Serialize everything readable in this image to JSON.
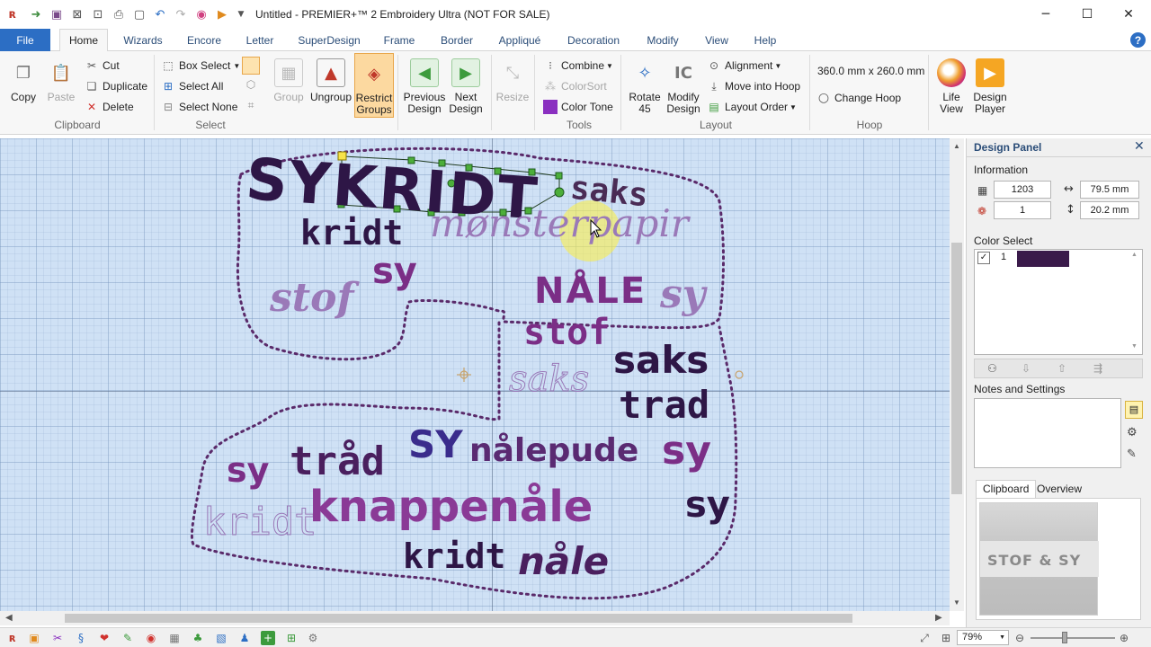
{
  "window": {
    "title": "Untitled - PREMIER+™ 2 Embroidery Ultra (NOT FOR SALE)",
    "minimize": "─",
    "maximize": "☐",
    "close": "✕"
  },
  "tabs": {
    "file": "File",
    "items": [
      "Home",
      "Wizards",
      "Encore",
      "Letter",
      "SuperDesign",
      "Frame",
      "Border",
      "Appliqué",
      "Decoration",
      "Modify",
      "View",
      "Help"
    ],
    "active": "Home"
  },
  "ribbon": {
    "clipboard": {
      "label": "Clipboard",
      "copy": "Copy",
      "paste": "Paste",
      "cut": "Cut",
      "duplicate": "Duplicate",
      "delete": "Delete"
    },
    "select": {
      "label": "Select",
      "box_select": "Box Select",
      "select_all": "Select All",
      "select_none": "Select None",
      "group": "Group",
      "ungroup": "Ungroup",
      "restrict_1": "Restrict",
      "restrict_2": "Groups"
    },
    "nav": {
      "prev_1": "Previous",
      "prev_2": "Design",
      "next_1": "Next",
      "next_2": "Design",
      "resize": "Resize"
    },
    "tools": {
      "label": "Tools",
      "combine": "Combine",
      "colorsort": "ColorSort",
      "color_tone": "Color Tone"
    },
    "layout": {
      "label": "Layout",
      "rotate_1": "Rotate",
      "rotate_2": "45",
      "modify_1": "Modify",
      "modify_2": "Design",
      "alignment": "Alignment",
      "move_into_hoop": "Move into Hoop",
      "layout_order": "Layout Order"
    },
    "hoop": {
      "label": "Hoop",
      "size": "360.0 mm x 260.0 mm",
      "change_hoop": "Change Hoop"
    },
    "view": {
      "life_1": "Life",
      "life_2": "View",
      "player_1": "Design",
      "player_2": "Player"
    }
  },
  "canvas": {
    "words": {
      "sykridt": "SYKRIDT",
      "saks1": "saks",
      "kridt1": "kridt",
      "monsterpapir": "mønsterpapir",
      "sy1": "sy",
      "stof1": "stof",
      "nale1": "NÅLE",
      "sy2": "sy",
      "stof2": "stof",
      "saks2": "saks",
      "saks3": "saks",
      "trad1": "trad",
      "sy3": "sy",
      "trad2": "tråd",
      "sy4": "SY",
      "nalepude": "nålepude",
      "sy5": "sy",
      "kridt2": "kridt",
      "knappenale": "knappenåle",
      "sy6": "sy",
      "kridt3": "kridt",
      "nale2": "nåle"
    },
    "colors": {
      "dark": "#2e1646",
      "purple": "#6a2c7d",
      "magenta": "#7b2e86",
      "lilac": "#9a79b8",
      "light": "#b7a3cf",
      "selection": "#3f9b2e"
    }
  },
  "panel": {
    "title": "Design Panel",
    "information": "Information",
    "stitches": "1203",
    "width": "79.5 mm",
    "colors": "1",
    "height": "20.2 mm",
    "color_select": "Color Select",
    "color_index": "1",
    "swatch_color": "#3a1a4a",
    "notes": "Notes and Settings",
    "tab_clipboard": "Clipboard",
    "tab_overview": "Overview",
    "preview_text": "STOF & SY"
  },
  "status": {
    "zoom": "79%"
  }
}
